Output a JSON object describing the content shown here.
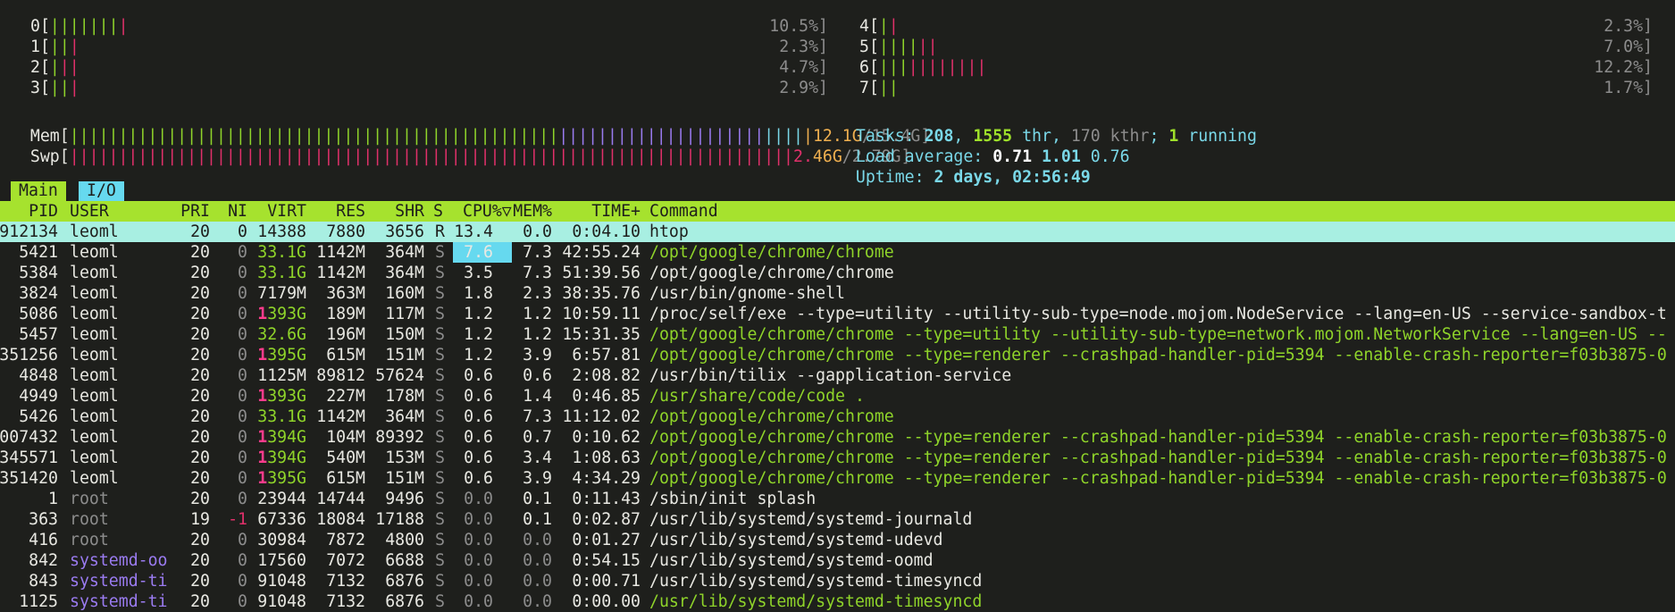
{
  "meters": {
    "cpus": [
      {
        "label": "0",
        "bars": [
          {
            "t": "|||||||",
            "c": "green"
          },
          {
            "t": "|",
            "c": "red"
          }
        ],
        "value": "10.5%]",
        "side": "left"
      },
      {
        "label": "1",
        "bars": [
          {
            "t": "||",
            "c": "green"
          },
          {
            "t": "|",
            "c": "red"
          }
        ],
        "value": "2.3%]",
        "side": "left"
      },
      {
        "label": "2",
        "bars": [
          {
            "t": "|",
            "c": "green"
          },
          {
            "t": "||",
            "c": "red"
          }
        ],
        "value": "4.7%]",
        "side": "left"
      },
      {
        "label": "3",
        "bars": [
          {
            "t": "||",
            "c": "green"
          },
          {
            "t": "|",
            "c": "red"
          }
        ],
        "value": "2.9%]",
        "side": "left"
      },
      {
        "label": "4",
        "bars": [
          {
            "t": "|",
            "c": "green"
          },
          {
            "t": "|",
            "c": "red"
          }
        ],
        "value": "2.3%]",
        "side": "right"
      },
      {
        "label": "5",
        "bars": [
          {
            "t": "||||",
            "c": "green"
          },
          {
            "t": "||",
            "c": "red"
          }
        ],
        "value": "7.0%]",
        "side": "right"
      },
      {
        "label": "6",
        "bars": [
          {
            "t": "|||",
            "c": "green"
          },
          {
            "t": "||||||||",
            "c": "red"
          }
        ],
        "value": "12.2%]",
        "side": "right"
      },
      {
        "label": "7",
        "bars": [
          {
            "t": "||",
            "c": "green"
          }
        ],
        "value": "1.7%]",
        "side": "right"
      }
    ],
    "mem": {
      "label": "Mem",
      "bars": [
        {
          "t": "||||||||||||||||||||||||||||||||||||||||||||||||||",
          "c": "green"
        },
        {
          "t": "|||||||||||||||||||||",
          "c": "purple"
        },
        {
          "t": "||||",
          "c": "cyan"
        },
        {
          "t": "|",
          "c": "orange"
        }
      ],
      "used": "12.1G",
      "total": "/15.4G]"
    },
    "swp": {
      "label": "Swp",
      "bars": [
        {
          "t": "||||||||||||||||||||||||||||||||||||||||||||||||||||||||||||||||||||||||||",
          "c": "red"
        }
      ],
      "used_a": "2.",
      "used_b": "46G",
      "total": "/2.79G]"
    }
  },
  "stats": {
    "tasks_label": "Tasks: ",
    "tasks": "208",
    "sep1": ", ",
    "threads": "1555",
    "thr_label": " thr",
    "sep2": ", ",
    "kthreads": "170 kthr",
    "sep3": "; ",
    "running": "1",
    "running_label": " running",
    "load_label": "Load average: ",
    "load1": "0.71",
    "load5": "1.01",
    "load15": "0.76",
    "uptime_label": "Uptime: ",
    "uptime": "2 days, 02:56:49"
  },
  "tabs": {
    "main": "Main",
    "io": "I/O"
  },
  "columns": {
    "pid": "PID",
    "user": "USER",
    "pri": "PRI",
    "ni": "NI",
    "virt": "VIRT",
    "res": "RES",
    "shr": "SHR",
    "s": "S",
    "cpu": "CPU%▽",
    "mem": "MEM%",
    "time": "TIME+",
    "cmd": "Command"
  },
  "processes": [
    {
      "pid": "912134",
      "user": "leoml",
      "pri": "20",
      "ni": "0",
      "virt": "14388",
      "virt_hi": "",
      "res": "7880",
      "shr": "3656",
      "s": "R",
      "cpu": "13.4",
      "mem": "0.0",
      "time": "0:04.10",
      "cmd": "htop",
      "cmd_color": "white",
      "user_color": "white",
      "selected": true
    },
    {
      "pid": "5421",
      "user": "leoml",
      "pri": "20",
      "ni": "0",
      "virt": "33.1G",
      "virt_hi": "",
      "res": "1142M",
      "shr": "364M",
      "s": "S",
      "cpu": "7.6",
      "mem": "7.3",
      "time": "42:55.24",
      "cmd": "/opt/google/chrome/chrome",
      "cmd_color": "green",
      "user_color": "white"
    },
    {
      "pid": "5384",
      "user": "leoml",
      "pri": "20",
      "ni": "0",
      "virt": "33.1G",
      "virt_hi": "",
      "res": "1142M",
      "shr": "364M",
      "s": "S",
      "cpu": "3.5",
      "mem": "7.3",
      "time": "51:39.56",
      "cmd": "/opt/google/chrome/chrome",
      "cmd_color": "white",
      "user_color": "white"
    },
    {
      "pid": "3824",
      "user": "leoml",
      "pri": "20",
      "ni": "0",
      "virt": "7179M",
      "virt_hi": "",
      "res": "363M",
      "shr": "160M",
      "s": "S",
      "cpu": "1.8",
      "mem": "2.3",
      "time": "38:35.76",
      "cmd": "/usr/bin/gnome-shell",
      "cmd_color": "white",
      "user_color": "white"
    },
    {
      "pid": "5086",
      "user": "leoml",
      "pri": "20",
      "ni": "0",
      "virt": "393G",
      "virt_hi": "1",
      "res": "189M",
      "shr": "117M",
      "s": "S",
      "cpu": "1.2",
      "mem": "1.2",
      "time": "10:59.11",
      "cmd": "/proc/self/exe --type=utility --utility-sub-type=node.mojom.NodeService --lang=en-US --service-sandbox-t",
      "cmd_color": "white",
      "user_color": "white"
    },
    {
      "pid": "5457",
      "user": "leoml",
      "pri": "20",
      "ni": "0",
      "virt": "32.6G",
      "virt_hi": "",
      "res": "196M",
      "shr": "150M",
      "s": "S",
      "cpu": "1.2",
      "mem": "1.2",
      "time": "15:31.35",
      "cmd": "/opt/google/chrome/chrome --type=utility --utility-sub-type=network.mojom.NetworkService --lang=en-US --",
      "cmd_color": "green",
      "user_color": "white"
    },
    {
      "pid": "351256",
      "user": "leoml",
      "pri": "20",
      "ni": "0",
      "virt": "395G",
      "virt_hi": "1",
      "res": "615M",
      "shr": "151M",
      "s": "S",
      "cpu": "1.2",
      "mem": "3.9",
      "time": "6:57.81",
      "cmd": "/opt/google/chrome/chrome --type=renderer --crashpad-handler-pid=5394 --enable-crash-reporter=f03b3875-0",
      "cmd_color": "green",
      "user_color": "white"
    },
    {
      "pid": "4848",
      "user": "leoml",
      "pri": "20",
      "ni": "0",
      "virt": "1125M",
      "virt_hi": "",
      "res": "89812",
      "shr": "57624",
      "s": "S",
      "cpu": "0.6",
      "mem": "0.6",
      "time": "2:08.82",
      "cmd": "/usr/bin/tilix --gapplication-service",
      "cmd_color": "white",
      "user_color": "white"
    },
    {
      "pid": "4949",
      "user": "leoml",
      "pri": "20",
      "ni": "0",
      "virt": "393G",
      "virt_hi": "1",
      "res": "227M",
      "shr": "178M",
      "s": "S",
      "cpu": "0.6",
      "mem": "1.4",
      "time": "0:46.85",
      "cmd": "/usr/share/code/code .",
      "cmd_color": "green",
      "user_color": "white"
    },
    {
      "pid": "5426",
      "user": "leoml",
      "pri": "20",
      "ni": "0",
      "virt": "33.1G",
      "virt_hi": "",
      "res": "1142M",
      "shr": "364M",
      "s": "S",
      "cpu": "0.6",
      "mem": "7.3",
      "time": "11:12.02",
      "cmd": "/opt/google/chrome/chrome",
      "cmd_color": "green",
      "user_color": "white"
    },
    {
      "pid": "007432",
      "user": "leoml",
      "pri": "20",
      "ni": "0",
      "virt": "394G",
      "virt_hi": "1",
      "res": "104M",
      "shr": "89392",
      "s": "S",
      "cpu": "0.6",
      "mem": "0.7",
      "time": "0:10.62",
      "cmd": "/opt/google/chrome/chrome --type=renderer --crashpad-handler-pid=5394 --enable-crash-reporter=f03b3875-0",
      "cmd_color": "green",
      "user_color": "white"
    },
    {
      "pid": "345571",
      "user": "leoml",
      "pri": "20",
      "ni": "0",
      "virt": "394G",
      "virt_hi": "1",
      "res": "540M",
      "shr": "153M",
      "s": "S",
      "cpu": "0.6",
      "mem": "3.4",
      "time": "1:08.63",
      "cmd": "/opt/google/chrome/chrome --type=renderer --crashpad-handler-pid=5394 --enable-crash-reporter=f03b3875-0",
      "cmd_color": "green",
      "user_color": "white"
    },
    {
      "pid": "351420",
      "user": "leoml",
      "pri": "20",
      "ni": "0",
      "virt": "395G",
      "virt_hi": "1",
      "res": "615M",
      "shr": "151M",
      "s": "S",
      "cpu": "0.6",
      "mem": "3.9",
      "time": "4:34.29",
      "cmd": "/opt/google/chrome/chrome --type=renderer --crashpad-handler-pid=5394 --enable-crash-reporter=f03b3875-0",
      "cmd_color": "green",
      "user_color": "white"
    },
    {
      "pid": "1",
      "user": "root",
      "pri": "20",
      "ni": "0",
      "virt": "23944",
      "virt_hi": "",
      "res": "14744",
      "shr": "9496",
      "s": "S",
      "cpu": "0.0",
      "mem": "0.1",
      "time": "0:11.43",
      "cmd": "/sbin/init splash",
      "cmd_color": "white",
      "user_color": "gray"
    },
    {
      "pid": "363",
      "user": "root",
      "pri": "19",
      "ni": "-1",
      "virt": "67336",
      "virt_hi": "",
      "res": "18084",
      "shr": "17188",
      "s": "S",
      "cpu": "0.0",
      "mem": "0.1",
      "time": "0:02.87",
      "cmd": "/usr/lib/systemd/systemd-journald",
      "cmd_color": "white",
      "user_color": "gray"
    },
    {
      "pid": "416",
      "user": "root",
      "pri": "20",
      "ni": "0",
      "virt": "30984",
      "virt_hi": "",
      "res": "7872",
      "shr": "4800",
      "s": "S",
      "cpu": "0.0",
      "mem": "0.0",
      "time": "0:01.27",
      "cmd": "/usr/lib/systemd/systemd-udevd",
      "cmd_color": "white",
      "user_color": "gray"
    },
    {
      "pid": "842",
      "user": "systemd-oo",
      "pri": "20",
      "ni": "0",
      "virt": "17560",
      "virt_hi": "",
      "res": "7072",
      "shr": "6688",
      "s": "S",
      "cpu": "0.0",
      "mem": "0.0",
      "time": "0:54.15",
      "cmd": "/usr/lib/systemd/systemd-oomd",
      "cmd_color": "white",
      "user_color": "purple"
    },
    {
      "pid": "843",
      "user": "systemd-ti",
      "pri": "20",
      "ni": "0",
      "virt": "91048",
      "virt_hi": "",
      "res": "7132",
      "shr": "6876",
      "s": "S",
      "cpu": "0.0",
      "mem": "0.0",
      "time": "0:00.71",
      "cmd": "/usr/lib/systemd/systemd-timesyncd",
      "cmd_color": "white",
      "user_color": "purple"
    },
    {
      "pid": "1125",
      "user": "systemd-ti",
      "pri": "20",
      "ni": "0",
      "virt": "91048",
      "virt_hi": "",
      "res": "7132",
      "shr": "6876",
      "s": "S",
      "cpu": "0.0",
      "mem": "0.0",
      "time": "0:00.00",
      "cmd": "/usr/lib/systemd/systemd-timesyncd",
      "cmd_color": "green",
      "user_color": "purple"
    }
  ]
}
